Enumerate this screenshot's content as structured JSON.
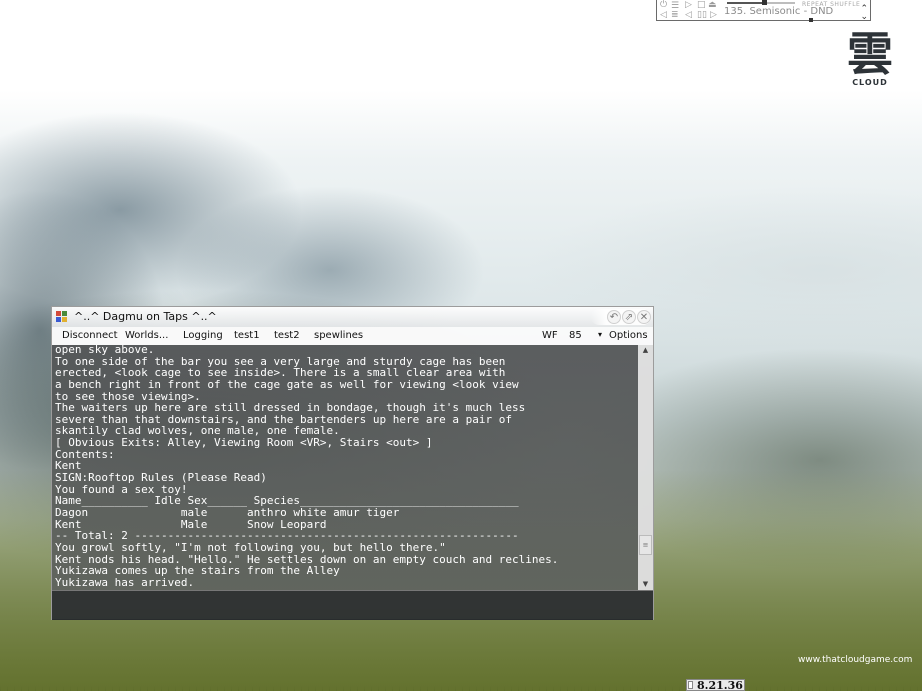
{
  "media_player": {
    "track": "135. Semisonic - DND",
    "modes": "REPEAT SHUFFLE",
    "progress": 0.55
  },
  "logo": {
    "glyph": "雲",
    "text": "CLOUD"
  },
  "window": {
    "title": "^..^ Dagmu on Taps ^..^",
    "menu": [
      "Disconnect",
      "Worlds...",
      "Logging",
      "test1",
      "test2",
      "spewlines"
    ],
    "wf_label": "WF",
    "wf_value": "85",
    "options_label": "Options",
    "output_lines": [
      "open sky above.",
      "To one side of the bar you see a very large and sturdy cage has been",
      "erected, <look cage to see inside>. There is a small clear area with",
      "a bench right in front of the cage gate as well for viewing <look view",
      "to see those viewing>.",
      "The waiters up here are still dressed in bondage, though it's much less",
      "severe than that downstairs, and the bartenders up here are a pair of",
      "skantily clad wolves, one male, one female.",
      "[ Obvious Exits: Alley, Viewing Room <VR>, Stairs <out> ]",
      "Contents:",
      "Kent",
      "SIGN:Rooftop Rules (Please Read)",
      "You found a sex toy!",
      "Name__________ Idle Sex______ Species_________________________________",
      "Dagon              male      anthro white amur tiger",
      "Kent               Male      Snow Leopard",
      "-- Total: 2 ----------------------------------------------------------",
      "You growl softly, \"I'm not following you, but hello there.\"",
      "Kent nods his head. \"Hello.\" He settles down on an empty couch and reclines.",
      "Yukizawa comes up the stairs from the Alley",
      "Yukizawa has arrived."
    ]
  },
  "footer": {
    "site_url": "www.thatcloudgame.com",
    "version": "8.21.36"
  },
  "colors": {
    "terminal_text": "#ffffff",
    "terminal_bg": "#2c3032"
  }
}
